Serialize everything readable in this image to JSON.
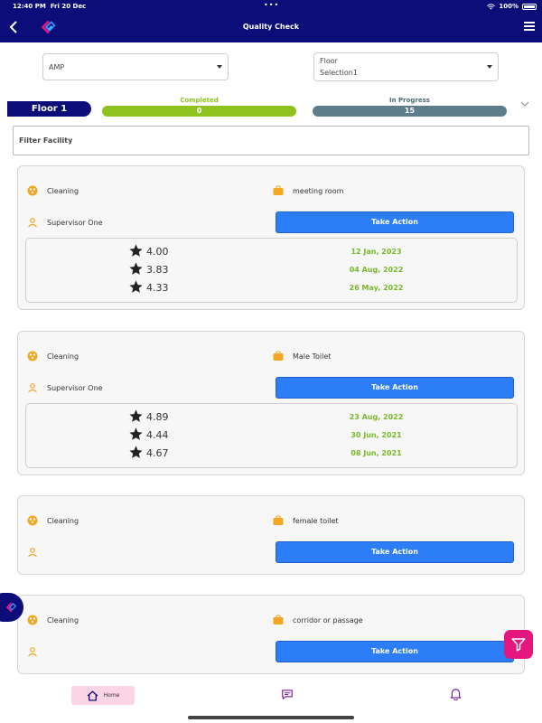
{
  "status_bar": {
    "time": "12:40 PM",
    "date": "Fri 20 Dec",
    "battery": "100%"
  },
  "header": {
    "title": "Quality Check"
  },
  "selectors": {
    "site": "AMP",
    "floor_line1": "Floor",
    "floor_line2": "Selection1"
  },
  "floor": {
    "name": "Floor 1"
  },
  "progress": {
    "completed_label": "Completed",
    "completed_count": "0",
    "completed_color": "#8dc21f",
    "in_progress_label": "In Progress",
    "in_progress_count": "15",
    "in_progress_color": "#5e7d8a"
  },
  "filter": {
    "placeholder": "Filter Facility"
  },
  "cards": [
    {
      "category": "Cleaning",
      "location": "meeting room",
      "supervisor": "Supervisor One",
      "action": "Take Action",
      "history": [
        {
          "rating": "4.00",
          "date": "12 Jan, 2023"
        },
        {
          "rating": "3.83",
          "date": "04 Aug, 2022"
        },
        {
          "rating": "4.33",
          "date": "26 May, 2022"
        }
      ]
    },
    {
      "category": "Cleaning",
      "location": "Male Toilet",
      "supervisor": "Supervisor One",
      "action": "Take Action",
      "history": [
        {
          "rating": "4.89",
          "date": "23 Aug, 2022"
        },
        {
          "rating": "4.44",
          "date": "30 Jun, 2021"
        },
        {
          "rating": "4.67",
          "date": "08 Jun, 2021"
        }
      ]
    },
    {
      "category": "Cleaning",
      "location": "female toilet",
      "supervisor": "",
      "action": "Take Action"
    },
    {
      "category": "Cleaning",
      "location": "corridor or passage",
      "supervisor": "",
      "action": "Take Action"
    }
  ],
  "bottom_nav": {
    "home_label": "Home"
  },
  "colors": {
    "brand": "#0d0d7a",
    "accent_pink": "#e6167f",
    "action_blue": "#2d7df6",
    "icon_orange": "#f5a623",
    "date_green": "#78b82a"
  }
}
